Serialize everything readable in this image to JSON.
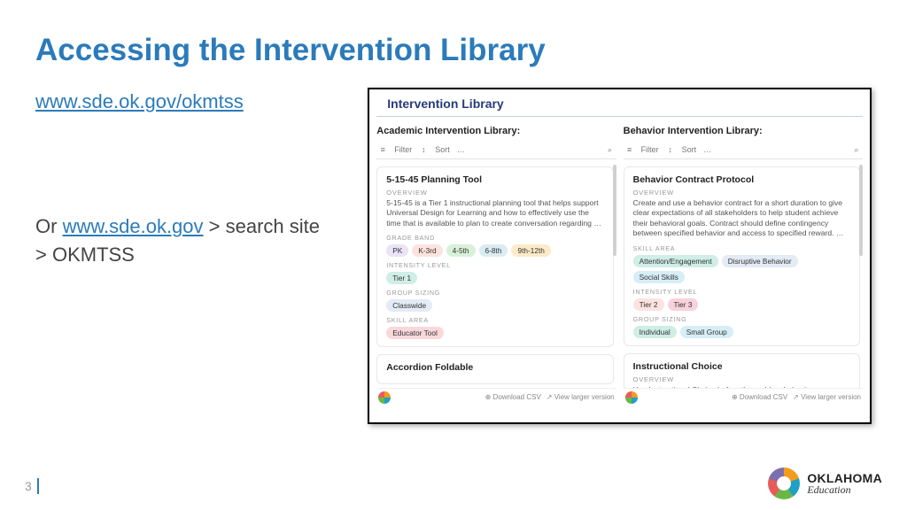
{
  "slide": {
    "title": "Accessing the Intervention Library",
    "link1": "www.sde.ok.gov/okmtss",
    "or_prefix": "Or ",
    "link2": "www.sde.ok.gov",
    "or_suffix": " > search site > OKMTSS",
    "page_number": "3"
  },
  "brand": {
    "line1": "OKLAHOMA",
    "line2": "Education"
  },
  "shot": {
    "header": "Intervention Library",
    "toolbar": {
      "filter": "Filter",
      "sort": "Sort",
      "more": "…",
      "download": "Download CSV",
      "view_larger": "View larger version"
    },
    "left": {
      "title": "Academic Intervention Library:",
      "cards": [
        {
          "title": "5-15-45 Planning Tool",
          "overview_label": "OVERVIEW",
          "overview": "5-15-45 is a Tier 1 instructional planning tool that helps support Universal Design for Learning and how to effectively use the time that is available to plan to create conversation regarding …",
          "fields": [
            {
              "label": "GRADE BAND",
              "pills": [
                {
                  "t": "PK",
                  "bg": "#e9e5f7"
                },
                {
                  "t": "K-3rd",
                  "bg": "#fde3de"
                },
                {
                  "t": "4-5th",
                  "bg": "#d9f0d9"
                },
                {
                  "t": "6-8th",
                  "bg": "#d9ecf2"
                },
                {
                  "t": "9th-12th",
                  "bg": "#fcebc8"
                }
              ]
            },
            {
              "label": "INTENSITY LEVEL",
              "pills": [
                {
                  "t": "Tier 1",
                  "bg": "#cfeee5"
                }
              ]
            },
            {
              "label": "GROUP SIZING",
              "pills": [
                {
                  "t": "Classwide",
                  "bg": "#e3ebf5"
                }
              ]
            },
            {
              "label": "SKILL AREA",
              "pills": [
                {
                  "t": "Educator Tool",
                  "bg": "#f9d8dc"
                }
              ]
            }
          ]
        },
        {
          "title": "Accordion Foldable"
        }
      ]
    },
    "right": {
      "title": "Behavior Intervention Library:",
      "cards": [
        {
          "title": "Behavior Contract Protocol",
          "overview_label": "OVERVIEW",
          "overview": "Create and use a behavior contract for a short duration to give clear expectations of all stakeholders to help student achieve their behavioral goals. Contract should define contingency between specified behavior and access to specified reward. …",
          "fields": [
            {
              "label": "SKILL AREA",
              "pills": [
                {
                  "t": "Attention/Engagement",
                  "bg": "#cfeee5"
                },
                {
                  "t": "Disruptive Behavior",
                  "bg": "#e3ebf5"
                },
                {
                  "t": "Social Skills",
                  "bg": "#d7eef7"
                }
              ]
            },
            {
              "label": "INTENSITY LEVEL",
              "pills": [
                {
                  "t": "Tier 2",
                  "bg": "#fde3de"
                },
                {
                  "t": "Tier 3",
                  "bg": "#f7d2dd"
                }
              ]
            },
            {
              "label": "GROUP SIZING",
              "pills": [
                {
                  "t": "Individual",
                  "bg": "#cfeee5"
                },
                {
                  "t": "Small Group",
                  "bg": "#d7eef7"
                }
              ]
            }
          ]
        },
        {
          "title": "Instructional Choice",
          "overview_label": "OVERVIEW",
          "overview": "Use Instructional Choice before the problem behavior occurs"
        }
      ]
    }
  }
}
